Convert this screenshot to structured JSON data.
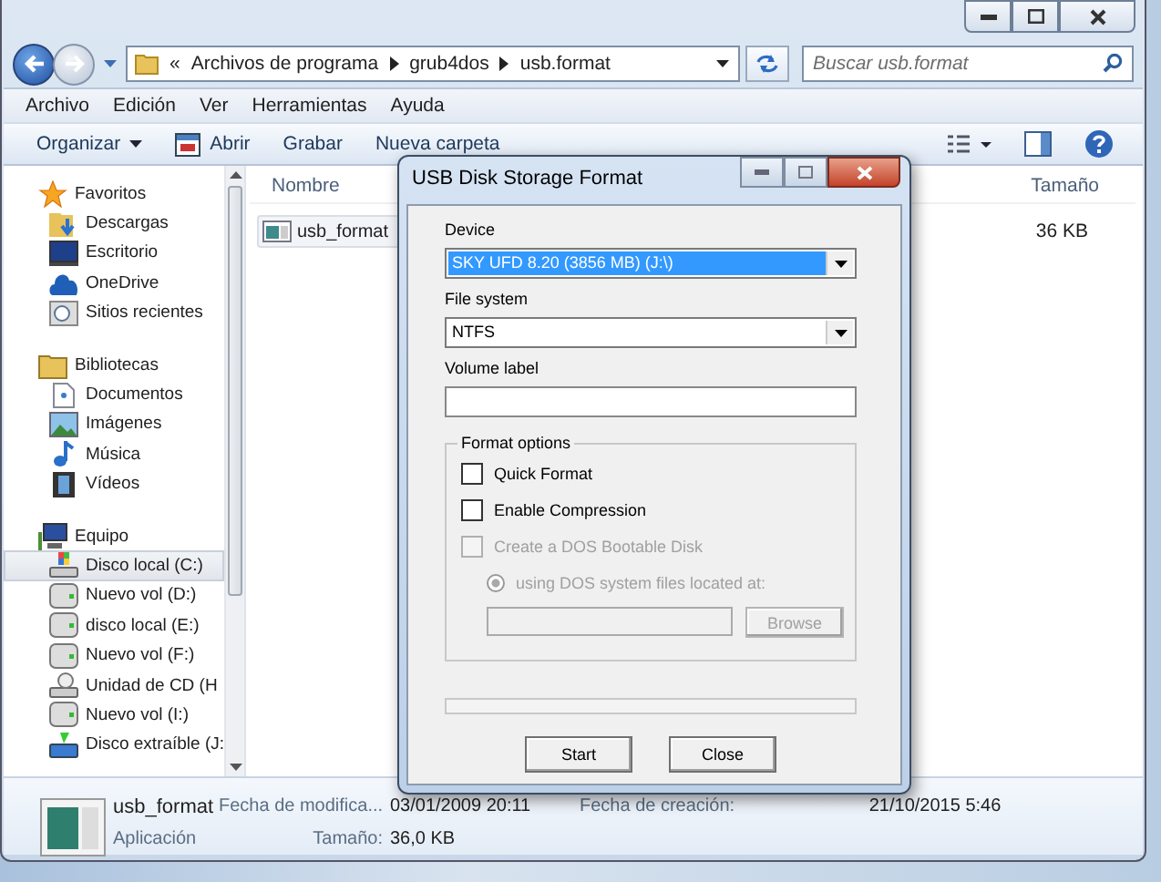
{
  "explorer": {
    "address": {
      "overflow": "«",
      "crumbs": [
        "Archivos de programa",
        "grub4dos",
        "usb.format"
      ]
    },
    "search": {
      "placeholder": "Buscar usb.format"
    },
    "menu": [
      "Archivo",
      "Edición",
      "Ver",
      "Herramientas",
      "Ayuda"
    ],
    "toolbar": [
      {
        "label": "Organizar",
        "kind": "dropdown"
      },
      {
        "label": "Abrir",
        "kind": "icon"
      },
      {
        "label": "Grabar",
        "kind": "plain"
      },
      {
        "label": "Nueva carpeta",
        "kind": "plain"
      }
    ],
    "nav": [
      {
        "label": "Favoritos",
        "kind": "star",
        "selected": false,
        "children": [
          {
            "label": "Descargas",
            "kind": "download",
            "selected": false
          },
          {
            "label": "Escritorio",
            "kind": "desktop",
            "selected": false
          },
          {
            "label": "OneDrive",
            "kind": "cloud",
            "selected": false
          },
          {
            "label": "Sitios recientes",
            "kind": "recent",
            "selected": false
          }
        ]
      },
      {
        "label": "Bibliotecas",
        "kind": "library",
        "selected": false,
        "children": [
          {
            "label": "Documentos",
            "kind": "document",
            "selected": false
          },
          {
            "label": "Imágenes",
            "kind": "picture",
            "selected": false
          },
          {
            "label": "Música",
            "kind": "music",
            "selected": false
          },
          {
            "label": "Vídeos",
            "kind": "video",
            "selected": false
          }
        ]
      },
      {
        "label": "Equipo",
        "kind": "computer",
        "selected": false,
        "children": [
          {
            "label": "Disco local (C:)",
            "kind": "system-drive",
            "selected": true
          },
          {
            "label": "Nuevo vol (D:)",
            "kind": "drive",
            "selected": false
          },
          {
            "label": "disco local (E:)",
            "kind": "drive",
            "selected": false
          },
          {
            "label": "Nuevo vol (F:)",
            "kind": "drive",
            "selected": false
          },
          {
            "label": "Unidad de CD (H",
            "kind": "cd",
            "selected": false
          },
          {
            "label": "Nuevo vol (I:)",
            "kind": "drive",
            "selected": false
          },
          {
            "label": "Disco extraíble (J:",
            "kind": "usb",
            "selected": false
          }
        ]
      }
    ],
    "columns": [
      "Nombre",
      "Tamaño"
    ],
    "files": [
      {
        "name": "usb_format",
        "size": "36 KB",
        "selected": true
      }
    ],
    "details": {
      "name": "usb_format",
      "type": "Aplicación",
      "modified": {
        "label": "Fecha de modifica...",
        "value": "03/01/2009 20:11"
      },
      "size": {
        "label": "Tamaño:",
        "value": "36,0 KB"
      },
      "created": {
        "label": "Fecha de creación:",
        "value": "21/10/2015 5:46"
      }
    }
  },
  "dialog": {
    "title": "USB Disk Storage Format",
    "device": {
      "label": "Device",
      "value": "SKY UFD 8.20 (3856 MB) (J:\\)",
      "focused": true
    },
    "file_system": {
      "label": "File system",
      "value": "NTFS",
      "focused": false
    },
    "volume_label": {
      "label": "Volume label"
    },
    "format_options": {
      "title": "Format options",
      "options": [
        {
          "label": "Quick Format",
          "checked": false,
          "disabled": false
        },
        {
          "label": "Enable Compression",
          "checked": false,
          "disabled": false
        },
        {
          "label": "Create a DOS Bootable Disk",
          "checked": false,
          "disabled": true
        }
      ],
      "dos_source": {
        "label": "using DOS system files located at:",
        "selected": true,
        "disabled": true
      },
      "browse": {
        "label": "Browse",
        "disabled": true
      }
    },
    "progress": {
      "level": 0
    },
    "buttons": [
      "Start",
      "Close"
    ]
  }
}
